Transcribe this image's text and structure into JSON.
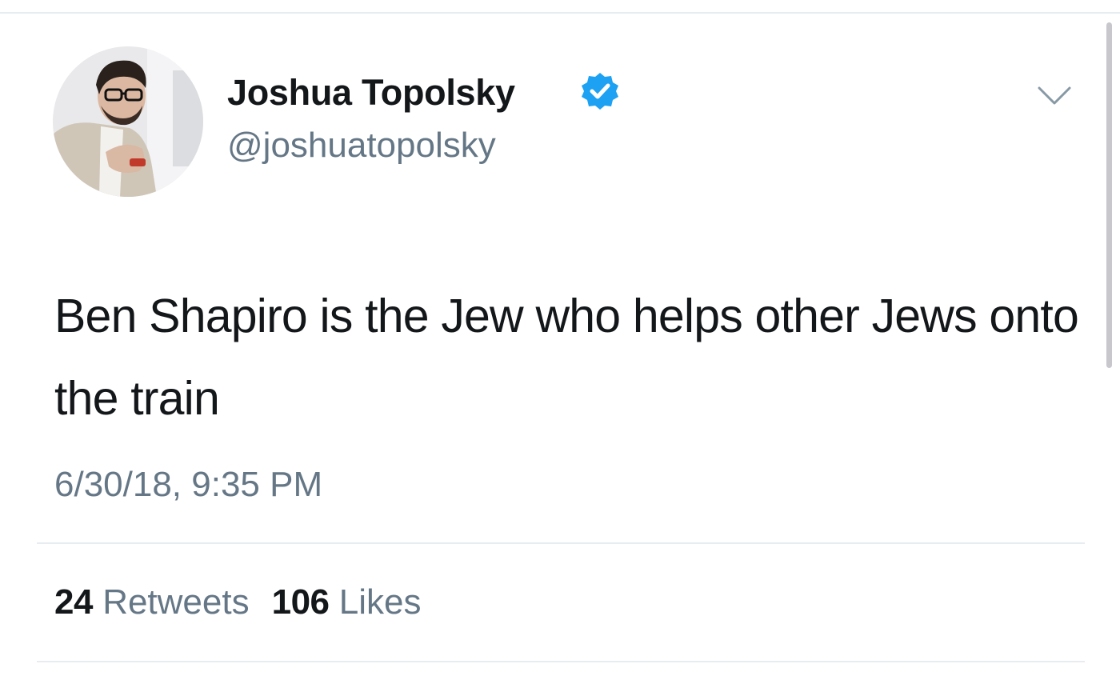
{
  "tweet": {
    "author": {
      "display_name": "Joshua Topolsky",
      "handle": "@joshuatopolsky",
      "verified": true,
      "avatar_icon": "profile-photo"
    },
    "text": "Ben Shapiro is the Jew who helps other Jews onto the train",
    "timestamp": "6/30/18, 9:35 PM",
    "stats": {
      "retweets_count": "24",
      "retweets_label": "Retweets",
      "likes_count": "106",
      "likes_label": "Likes"
    },
    "menu_icon": "chevron-down-icon"
  },
  "colors": {
    "primary_text": "#14171a",
    "secondary_text": "#657786",
    "verified_blue": "#1da1f2",
    "divider": "#e6ecf0"
  }
}
